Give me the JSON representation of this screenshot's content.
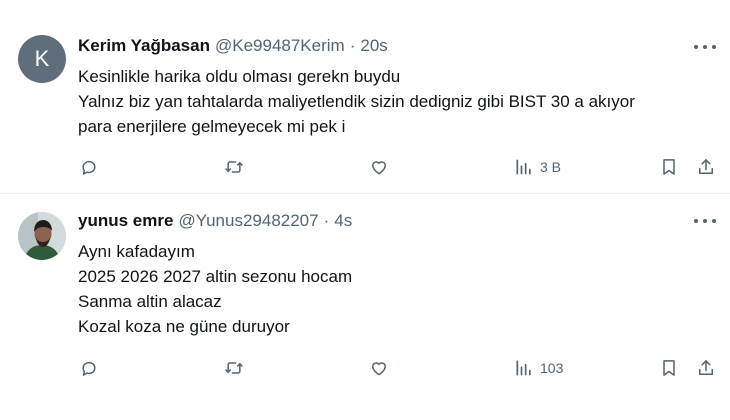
{
  "tweets": [
    {
      "avatar_letter": "K",
      "name": "Kerim Yağbasan",
      "handle": "@Ke99487Kerim",
      "dot": "·",
      "time": "20s",
      "lines": [
        "Kesinlikle harika oldu olması gerekn buydu",
        "Yalnız biz yan tahtalarda maliyetlendik sizin dedigniz gibi BIST 30 a akıyor",
        "para enerjilere gelmeyecek mi pek i"
      ],
      "views": "3 B"
    },
    {
      "name": "yunus emre",
      "handle": "@Yunus29482207",
      "dot": "·",
      "time": "4s",
      "lines": [
        "Aynı kafadayım",
        "2025 2026 2027 altin sezonu hocam",
        "Sanma altin alacaz",
        "Kozal koza ne güne duruyor"
      ],
      "views": "103"
    }
  ],
  "icons": {
    "reply": "reply-icon",
    "retweet": "retweet-icon",
    "like": "like-icon",
    "views": "views-icon",
    "bookmark": "bookmark-icon",
    "share": "share-icon",
    "more": "more-icon"
  },
  "colors": {
    "text": "#0f1419",
    "secondary": "#536471",
    "divider": "#eff3f4",
    "avatar_bg": "#5f6e7a"
  }
}
